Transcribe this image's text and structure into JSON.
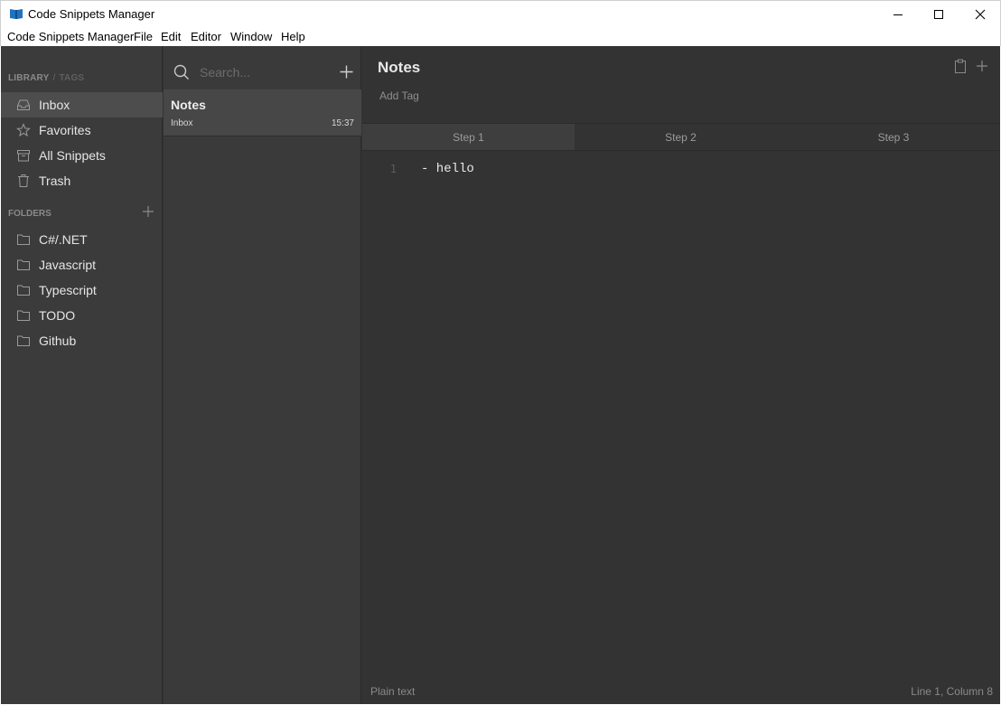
{
  "window": {
    "title": "Code Snippets Manager",
    "minimize_icon": "minimize-icon",
    "maximize_icon": "maximize-icon",
    "close_icon": "close-icon"
  },
  "menu": [
    "Code Snippets Manager",
    "File",
    "Edit",
    "Editor",
    "Window",
    "Help"
  ],
  "sidebar": {
    "library_label": "LIBRARY",
    "separator": "/",
    "tags_label": "TAGS",
    "library_items": [
      {
        "label": "Inbox",
        "icon": "inbox-icon",
        "active": true
      },
      {
        "label": "Favorites",
        "icon": "star-icon"
      },
      {
        "label": "All Snippets",
        "icon": "archive-icon"
      },
      {
        "label": "Trash",
        "icon": "trash-icon"
      }
    ],
    "folders_label": "FOLDERS",
    "folders": [
      {
        "label": "C#/.NET",
        "icon": "folder-icon"
      },
      {
        "label": "Javascript",
        "icon": "folder-icon"
      },
      {
        "label": "Typescript",
        "icon": "folder-icon"
      },
      {
        "label": "TODO",
        "icon": "folder-icon"
      },
      {
        "label": "Github",
        "icon": "folder-icon"
      }
    ]
  },
  "snippet_list": {
    "search_placeholder": "Search...",
    "items": [
      {
        "title": "Notes",
        "folder": "Inbox",
        "time": "15:37"
      }
    ]
  },
  "editor": {
    "title": "Notes",
    "add_tag": "Add Tag",
    "tabs": [
      {
        "label": "Step 1",
        "active": true
      },
      {
        "label": "Step 2"
      },
      {
        "label": "Step 3"
      }
    ],
    "lines": [
      {
        "number": "1",
        "text": "- hello"
      }
    ],
    "language": "Plain text",
    "cursor_position": "Line 1, Column 8"
  },
  "colors": {
    "sidebar_bg": "#3b3b3b",
    "list_bg": "#3a3a3a",
    "editor_bg": "#333333",
    "active_item_bg": "#4d4d4d",
    "app_icon_blue": "#1e73be"
  }
}
